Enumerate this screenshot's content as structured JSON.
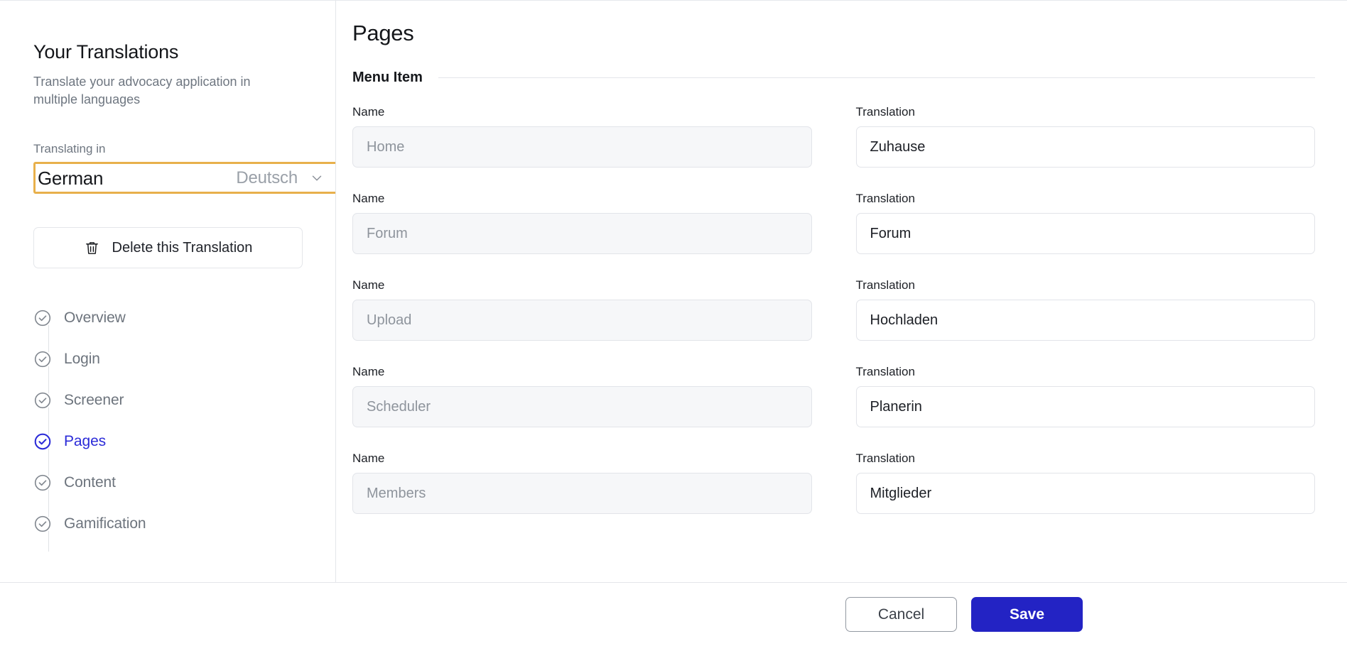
{
  "sidebar": {
    "title": "Your Translations",
    "subtitle": "Translate your advocacy application in multiple languages",
    "translating_in_label": "Translating in",
    "language": {
      "name": "German",
      "native": "Deutsch",
      "chevron_icon": "chevron-down-icon"
    },
    "delete_button": {
      "label": "Delete this Translation",
      "icon": "trash-icon"
    },
    "nav_items": [
      {
        "label": "Overview",
        "icon": "check-circle-icon",
        "active": false
      },
      {
        "label": "Login",
        "icon": "check-circle-icon",
        "active": false
      },
      {
        "label": "Screener",
        "icon": "check-circle-icon",
        "active": false
      },
      {
        "label": "Pages",
        "icon": "check-circle-icon",
        "active": true
      },
      {
        "label": "Content",
        "icon": "check-circle-icon",
        "active": false
      },
      {
        "label": "Gamification",
        "icon": "check-circle-icon",
        "active": false
      }
    ]
  },
  "main": {
    "page_title": "Pages",
    "section_title": "Menu Item",
    "labels": {
      "name": "Name",
      "translation": "Translation"
    },
    "rows": [
      {
        "name": "Home",
        "translation": "Zuhause"
      },
      {
        "name": "Forum",
        "translation": "Forum"
      },
      {
        "name": "Upload",
        "translation": "Hochladen"
      },
      {
        "name": "Scheduler",
        "translation": "Planerin"
      },
      {
        "name": "Members",
        "translation": "Mitglieder"
      }
    ]
  },
  "footer": {
    "cancel_label": "Cancel",
    "save_label": "Save"
  },
  "colors": {
    "accent_blue": "#2323c4",
    "active_nav_blue": "#2b2bd8",
    "highlight_amber": "#e8b04b",
    "disabled_field_bg": "#f6f7f9",
    "border_gray": "#e4e6ea"
  }
}
